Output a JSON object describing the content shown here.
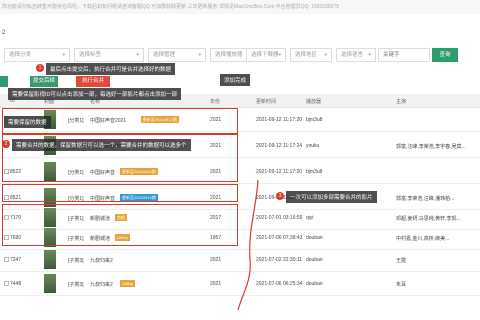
{
  "topbar": {
    "text": "改功能请勿私自转售可能存在风险，下载后如有问题请咨询客服QQ 可加群获取更新  三年更新服务 详情见MacCmsBox.Com 平台管理员QQ: 1693336575"
  },
  "page_number": "2",
  "filters": {
    "category": "选择分类",
    "tag": "选择标签",
    "progress": "选择管理",
    "player": "选择播放器",
    "download": "选择下载器",
    "area": "选择地区",
    "lang": "选择语言",
    "keyword_placeholder": "关键字",
    "search_label": "查询"
  },
  "buttons": {
    "submit": "提交后续",
    "merge": "执行合并",
    "add_done": "添加完成",
    "left": ""
  },
  "table": {
    "headers": [
      "ID",
      "封面",
      "名称",
      "年份",
      "更新时间",
      "播放器",
      "主演"
    ],
    "rows": [
      {
        "id": "",
        "category": "[分类1]",
        "name": "中国好声音2021",
        "badge": "更新至20210912期",
        "badge_color": "#e8a23a",
        "year": "2021",
        "time": "2021-09-12 11:17:20",
        "player": "bjm3u8",
        "actors": ""
      },
      {
        "id": "",
        "category": "[分类1]",
        "name": "中国好声音2021",
        "badge": "",
        "badge_color": "",
        "year": "2021",
        "time": "2021-09-12 11:17:24",
        "player": "youku",
        "actors": "郭富,汪峰,李荣浩,李宇春,吴莫..."
      },
      {
        "id": "8522",
        "category": "[分类1]",
        "name": "中国好声音",
        "badge": "更新至20210912期",
        "badge_color": "#e8a23a",
        "year": "2021",
        "time": "2021-09-12 11:17:20",
        "player": "bjm3u8",
        "actors": ""
      },
      {
        "id": "8521",
        "category": "[分类1]",
        "name": "中国好声音",
        "badge": "更新至20210912期",
        "badge_color": "#2f9bd6",
        "year": "2021",
        "time": "2021-09-12 11:17:24",
        "player": "youku",
        "actors": "郭富,李荣浩,汪峰,潘玮柏..."
      },
      {
        "id": "7170",
        "category": "[子类1]",
        "name": "新剧城池",
        "badge": "完结",
        "badge_color": "#e8a23a",
        "year": "2017",
        "time": "2021-07-01 03:16:59",
        "player": "qiyi",
        "actors": "邓超,姜妍,马思纯,黄轩,李凯..."
      },
      {
        "id": "7690",
        "category": "[子类1]",
        "name": "新剧城池",
        "badge": "1080p",
        "badge_color": "#e8a23a",
        "year": "1957",
        "time": "2021-07-06 07:38:43",
        "player": "douban",
        "actors": "中村嘉,金川,高桥,麻美..."
      },
      {
        "id": "7247",
        "category": "[子类3]",
        "name": "九叔归来2",
        "badge": "",
        "badge_color": "",
        "year": "2021",
        "time": "2021-07-02 22:30:11",
        "player": "douban",
        "actors": "王霆"
      },
      {
        "id": "7448",
        "category": "[子类3]",
        "name": "九叔归来2",
        "badge": "1080p",
        "badge_color": "#e8a23a",
        "year": "2021",
        "time": "2021-07-06 06:25:34",
        "player": "douban",
        "actors": "朱耳"
      }
    ]
  },
  "annotations": {
    "n1": "1",
    "note1": "最后点击提交后，执行合并可是合并选择好的数据",
    "note_add": "添加完成",
    "note2": "需要保留影视ID可以点击添加一部，每选好一部影片都点击添加一部",
    "note3": "需要保留的数据",
    "n2": "2",
    "note4": "需要合并的数据，保留数据只可以选一个，需要合并的数据可以选多个",
    "n3": "3",
    "note5": "一次可以添加多部需要合并的影片"
  },
  "colors": {
    "accent_green": "#2e9c6f",
    "red": "#d93a2b"
  }
}
